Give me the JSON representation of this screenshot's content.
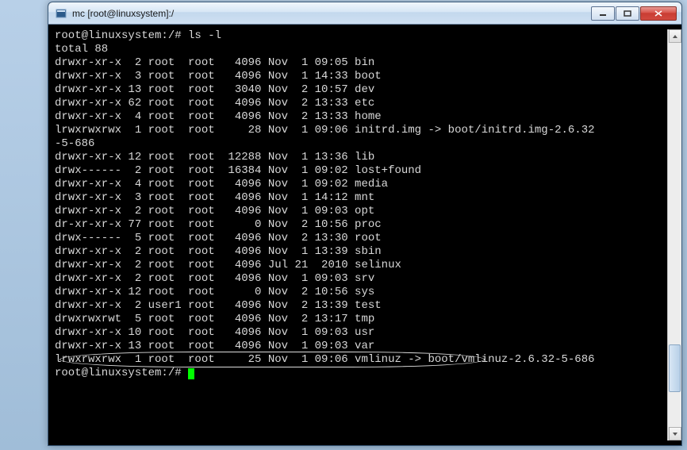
{
  "window": {
    "title": "mc [root@linuxsystem]:/",
    "icon": "terminal-icon"
  },
  "terminal": {
    "prompt1": "root@linuxsystem:/# ",
    "command": "ls -l",
    "total_line": "total 88",
    "rows": [
      {
        "perm": "drwxr-xr-x",
        "links": " 2",
        "owner": "root ",
        "group": "root",
        "size": "  4096",
        "mon": "Nov",
        "day": " 1",
        "time": "09:05",
        "name": "bin"
      },
      {
        "perm": "drwxr-xr-x",
        "links": " 3",
        "owner": "root ",
        "group": "root",
        "size": "  4096",
        "mon": "Nov",
        "day": " 1",
        "time": "14:33",
        "name": "boot"
      },
      {
        "perm": "drwxr-xr-x",
        "links": "13",
        "owner": "root ",
        "group": "root",
        "size": "  3040",
        "mon": "Nov",
        "day": " 2",
        "time": "10:57",
        "name": "dev"
      },
      {
        "perm": "drwxr-xr-x",
        "links": "62",
        "owner": "root ",
        "group": "root",
        "size": "  4096",
        "mon": "Nov",
        "day": " 2",
        "time": "13:33",
        "name": "etc"
      },
      {
        "perm": "drwxr-xr-x",
        "links": " 4",
        "owner": "root ",
        "group": "root",
        "size": "  4096",
        "mon": "Nov",
        "day": " 2",
        "time": "13:33",
        "name": "home"
      },
      {
        "perm": "lrwxrwxrwx",
        "links": " 1",
        "owner": "root ",
        "group": "root",
        "size": "    28",
        "mon": "Nov",
        "day": " 1",
        "time": "09:06",
        "name": "initrd.img -> boot/initrd.img-2.6.32"
      }
    ],
    "wrap_tail": "-5-686",
    "rows2": [
      {
        "perm": "drwxr-xr-x",
        "links": "12",
        "owner": "root ",
        "group": "root",
        "size": " 12288",
        "mon": "Nov",
        "day": " 1",
        "time": "13:36",
        "name": "lib"
      },
      {
        "perm": "drwx------",
        "links": " 2",
        "owner": "root ",
        "group": "root",
        "size": " 16384",
        "mon": "Nov",
        "day": " 1",
        "time": "09:02",
        "name": "lost+found"
      },
      {
        "perm": "drwxr-xr-x",
        "links": " 4",
        "owner": "root ",
        "group": "root",
        "size": "  4096",
        "mon": "Nov",
        "day": " 1",
        "time": "09:02",
        "name": "media"
      },
      {
        "perm": "drwxr-xr-x",
        "links": " 3",
        "owner": "root ",
        "group": "root",
        "size": "  4096",
        "mon": "Nov",
        "day": " 1",
        "time": "14:12",
        "name": "mnt"
      },
      {
        "perm": "drwxr-xr-x",
        "links": " 2",
        "owner": "root ",
        "group": "root",
        "size": "  4096",
        "mon": "Nov",
        "day": " 1",
        "time": "09:03",
        "name": "opt"
      },
      {
        "perm": "dr-xr-xr-x",
        "links": "77",
        "owner": "root ",
        "group": "root",
        "size": "     0",
        "mon": "Nov",
        "day": " 2",
        "time": "10:56",
        "name": "proc"
      },
      {
        "perm": "drwx------",
        "links": " 5",
        "owner": "root ",
        "group": "root",
        "size": "  4096",
        "mon": "Nov",
        "day": " 2",
        "time": "13:30",
        "name": "root"
      },
      {
        "perm": "drwxr-xr-x",
        "links": " 2",
        "owner": "root ",
        "group": "root",
        "size": "  4096",
        "mon": "Nov",
        "day": " 1",
        "time": "13:39",
        "name": "sbin"
      },
      {
        "perm": "drwxr-xr-x",
        "links": " 2",
        "owner": "root ",
        "group": "root",
        "size": "  4096",
        "mon": "Jul",
        "day": "21",
        "time": " 2010",
        "name": "selinux"
      },
      {
        "perm": "drwxr-xr-x",
        "links": " 2",
        "owner": "root ",
        "group": "root",
        "size": "  4096",
        "mon": "Nov",
        "day": " 1",
        "time": "09:03",
        "name": "srv"
      },
      {
        "perm": "drwxr-xr-x",
        "links": "12",
        "owner": "root ",
        "group": "root",
        "size": "     0",
        "mon": "Nov",
        "day": " 2",
        "time": "10:56",
        "name": "sys"
      },
      {
        "perm": "drwxr-xr-x",
        "links": " 2",
        "owner": "user1",
        "group": "root",
        "size": "  4096",
        "mon": "Nov",
        "day": " 2",
        "time": "13:39",
        "name": "test"
      },
      {
        "perm": "drwxrwxrwt",
        "links": " 5",
        "owner": "root ",
        "group": "root",
        "size": "  4096",
        "mon": "Nov",
        "day": " 2",
        "time": "13:17",
        "name": "tmp"
      },
      {
        "perm": "drwxr-xr-x",
        "links": "10",
        "owner": "root ",
        "group": "root",
        "size": "  4096",
        "mon": "Nov",
        "day": " 1",
        "time": "09:03",
        "name": "usr"
      },
      {
        "perm": "drwxr-xr-x",
        "links": "13",
        "owner": "root ",
        "group": "root",
        "size": "  4096",
        "mon": "Nov",
        "day": " 1",
        "time": "09:03",
        "name": "var"
      },
      {
        "perm": "lrwxrwxrwx",
        "links": " 1",
        "owner": "root ",
        "group": "root",
        "size": "    25",
        "mon": "Nov",
        "day": " 1",
        "time": "09:06",
        "name": "vmlinuz -> boot/vmlinuz-2.6.32-5-686"
      }
    ],
    "prompt2": "root@linuxsystem:/# "
  }
}
